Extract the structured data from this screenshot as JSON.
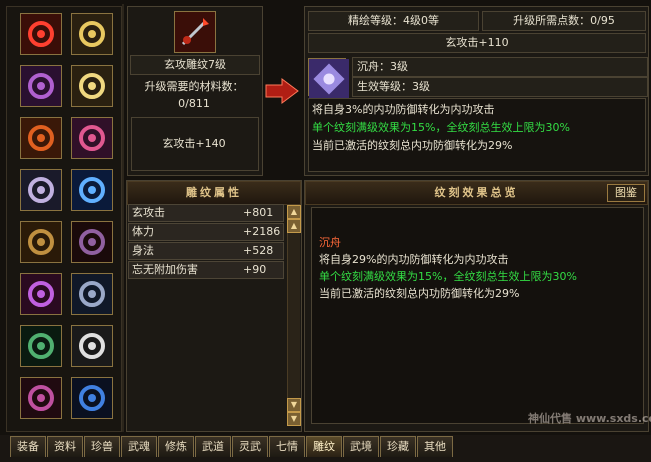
{
  "equipment_slots": [
    {
      "name": "amulet-red-gem-icon"
    },
    {
      "name": "gold-ring-icon"
    },
    {
      "name": "purple-helmet-icon"
    },
    {
      "name": "gold-ring-2-icon"
    },
    {
      "name": "scroll-bracer-icon"
    },
    {
      "name": "pink-bracer-icon"
    },
    {
      "name": "silver-wing-icon"
    },
    {
      "name": "blue-sword-icon"
    },
    {
      "name": "belt-icon"
    },
    {
      "name": "gauntlet-icon"
    },
    {
      "name": "purple-crossbow-icon"
    },
    {
      "name": "boots-icon"
    },
    {
      "name": "jade-pendant-icon"
    },
    {
      "name": "white-charm-icon"
    },
    {
      "name": "purple-necklace-icon"
    },
    {
      "name": "blue-shuriken-icon"
    }
  ],
  "carving": {
    "name": "玄攻雕纹7级",
    "material_label": "升级需要的材料数：",
    "material_value": "0/811",
    "attack_bonus": "玄攻击+140"
  },
  "upgrade": {
    "fine_level": "精绘等级：4级0等",
    "points_needed": "升级所需点数：0/95",
    "attack_bonus": "玄攻击+110",
    "skill_name": "沉舟：3级",
    "effect_level": "生效等级：3级",
    "desc1": "将自身3%的内功防御转化为内功攻击",
    "desc2": "单个纹刻满级效果为15%，全纹刻总生效上限为30%",
    "desc3": "当前已激活的纹刻总内功防御转化为29%"
  },
  "attributes": {
    "title": "雕纹属性",
    "rows": [
      {
        "label": "玄攻击",
        "value": "+801"
      },
      {
        "label": "体力",
        "value": "+2186"
      },
      {
        "label": "身法",
        "value": "+528"
      },
      {
        "label": "忘无附加伤害",
        "value": "+90"
      }
    ]
  },
  "overview": {
    "title": "纹刻效果总览",
    "button": "图鉴",
    "entry_name": "沉舟",
    "line1": "将自身29%的内功防御转化为内功攻击",
    "line2": "单个纹刻满级效果为15%，全纹刻总生效上限为30%",
    "line3": "当前已激活的纹刻总内功防御转化为29%"
  },
  "tabs": [
    "装备",
    "资料",
    "珍兽",
    "武魂",
    "修炼",
    "武道",
    "灵武",
    "七情",
    "雕纹",
    "武境",
    "珍藏",
    "其他"
  ],
  "active_tab": "雕纹",
  "watermark": "神仙代售 www.sxds.com"
}
